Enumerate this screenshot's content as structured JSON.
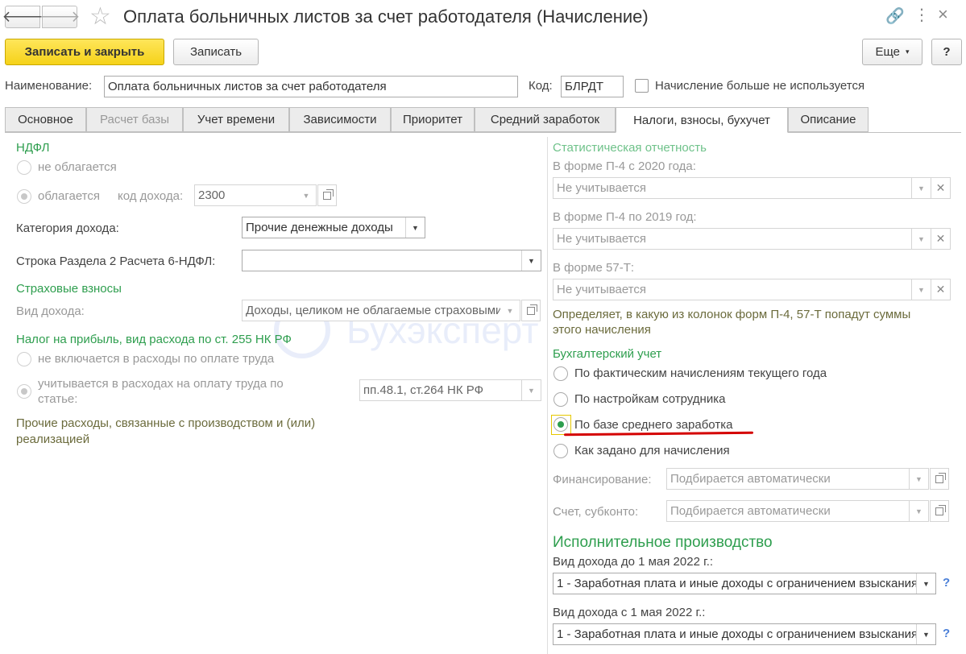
{
  "window": {
    "title": "Оплата больничных листов за счет работодателя (Начисление)"
  },
  "toolbar": {
    "save_close_label": "Записать и закрыть",
    "save_label": "Записать",
    "more_label": "Еще",
    "help_label": "?"
  },
  "header": {
    "name_label": "Наименование:",
    "name_value": "Оплата больничных листов за счет работодателя",
    "code_label": "Код:",
    "code_value": "БЛРДТ",
    "unused_label": "Начисление больше не используется"
  },
  "tabs": [
    {
      "label": "Основное"
    },
    {
      "label": "Расчет базы"
    },
    {
      "label": "Учет времени"
    },
    {
      "label": "Зависимости"
    },
    {
      "label": "Приоритет"
    },
    {
      "label": "Средний заработок"
    },
    {
      "label": "Налоги, взносы, бухучет"
    },
    {
      "label": "Описание"
    }
  ],
  "left": {
    "ndfl_title": "НДФЛ",
    "ndfl_not_taxed": "не облагается",
    "ndfl_taxed": "облагается",
    "income_code_label": "код дохода:",
    "income_code_value": "2300",
    "income_category_label": "Категория дохода:",
    "income_category_value": "Прочие денежные доходы",
    "section2_label": "Строка Раздела 2 Расчета 6-НДФЛ:",
    "section2_value": "",
    "insurance_title": "Страховые взносы",
    "income_type_label": "Вид дохода:",
    "income_type_value": "Доходы, целиком не облагаемые страховыми взносами",
    "profit_tax_title": "Налог на прибыль, вид расхода по ст. 255 НК РФ",
    "not_included": "не включается в расходы по оплате труда",
    "included_line1": "учитывается в расходах на оплату труда по",
    "included_line2": "статье:",
    "article_value": "пп.48.1, ст.264 НК РФ",
    "other_expenses_line1": "Прочие расходы, связанные с производством и (или)",
    "other_expenses_line2": "реализацией"
  },
  "right": {
    "stat_title": "Статистическая отчетность",
    "p4_2020_label": "В форме П-4 с 2020 года:",
    "p4_2020_value": "Не учитывается",
    "p4_2019_label": "В форме П-4 по 2019 год:",
    "p4_2019_value": "Не учитывается",
    "f57t_label": "В форме 57-Т:",
    "f57t_value": "Не учитывается",
    "stat_note_line1": "Определяет, в какую из колонок форм П-4, 57-Т попадут суммы",
    "stat_note_line2": "этого начисления",
    "accounting_title": "Бухгалтерский учет",
    "acc_option1": "По фактическим начислениям текущего года",
    "acc_option2": "По настройкам сотрудника",
    "acc_option3": "По базе среднего заработка",
    "acc_option4": "Как задано для начисления",
    "financing_label": "Финансирование:",
    "financing_value": "Подбирается автоматически",
    "account_label": "Счет, субконто:",
    "account_value": "Подбирается автоматически",
    "enforcement_title": "Исполнительное производство",
    "before_may_label": "Вид дохода до 1 мая 2022 г.:",
    "before_may_value": "1 - Заработная плата и иные доходы с ограничением взыскания",
    "after_may_label": "Вид дохода с 1 мая 2022 г.:",
    "after_may_value": "1 - Заработная плата и иные доходы с ограничением взыскания",
    "help_mark": "?"
  },
  "watermark": "Бухэксперт",
  "colors": {
    "accent_green": "#2e9e4e",
    "primary_button": "#f5d219",
    "underline_red": "#d40000"
  }
}
